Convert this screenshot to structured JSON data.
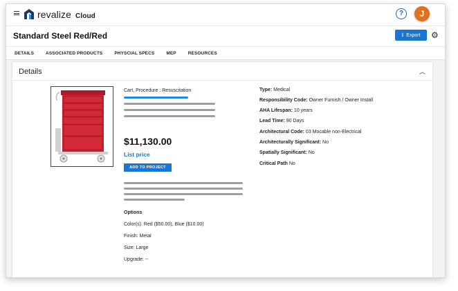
{
  "app": {
    "brand": "revalize",
    "brand_suffix": "Cloud",
    "avatar_initial": "J",
    "help_glyph": "?",
    "accent_color": "#1976d2",
    "avatar_color": "#e06f1f"
  },
  "header": {
    "title": "Standard Steel Red/Red",
    "export_label": "Export"
  },
  "tabs": [
    {
      "label": "DETAILS"
    },
    {
      "label": "ASSOCIATED PRODUCTS"
    },
    {
      "label": "PHYSCIAL SPECS"
    },
    {
      "label": "MEP"
    },
    {
      "label": "RESOURCES"
    }
  ],
  "details": {
    "title": "Details",
    "category": "Cart, Procedure : Resuscitation",
    "price": "$11,130.00",
    "list_price_label": "List price",
    "add_button_label": "ADD TO PROJECT",
    "options": {
      "title": "Options",
      "items": [
        "Color(s): Red ($50.00), Blue ($10.00)",
        "Finish: Metal",
        "Size: Large",
        "Upgrade: --"
      ]
    },
    "attributes": [
      {
        "label": "Type:",
        "value": "Medical"
      },
      {
        "label": "Responsibility Code:",
        "value": "Owner Furnish / Owner Install"
      },
      {
        "label": "AHA Lifespan:",
        "value": "10 years"
      },
      {
        "label": "Lead Time:",
        "value": "90 Days"
      },
      {
        "label": "Architectural Code:",
        "value": "03 Mocable non-Electrical"
      },
      {
        "label": "Architecturally Significant:",
        "value": "No"
      },
      {
        "label": "Spatially Significant:",
        "value": "No"
      },
      {
        "label": "Critical Path",
        "value": "No"
      }
    ]
  },
  "icons": {
    "menu": "menu-icon",
    "help": "help-icon",
    "export": "download-icon",
    "settings": "gear-icon",
    "collapse": "chevron-up-icon"
  }
}
